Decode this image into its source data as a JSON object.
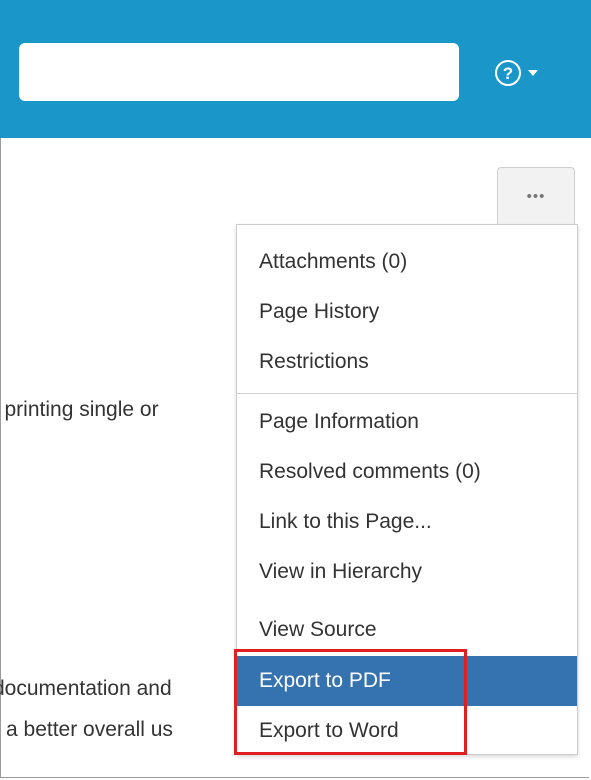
{
  "search": {
    "value": "",
    "placeholder": ""
  },
  "help": {
    "icon": "help-icon",
    "caret_icon": "chevron-down-icon"
  },
  "more_button": {
    "label": "•••"
  },
  "body_text": {
    "line1": "l printing single or",
    "line2": "documentation and",
    "line3": "a better overall us"
  },
  "menu": {
    "items": [
      {
        "label": "Attachments (0)"
      },
      {
        "label": "Page History"
      },
      {
        "label": "Restrictions"
      },
      {
        "label": "Page Information"
      },
      {
        "label": "Resolved comments (0)"
      },
      {
        "label": "Link to this Page..."
      },
      {
        "label": "View in Hierarchy"
      },
      {
        "label": "View Source"
      },
      {
        "label": "Export to PDF"
      },
      {
        "label": "Export to Word"
      }
    ]
  },
  "colors": {
    "header": "#1a97c8",
    "menu_active": "#3572b0",
    "highlight_box": "#e02020"
  }
}
